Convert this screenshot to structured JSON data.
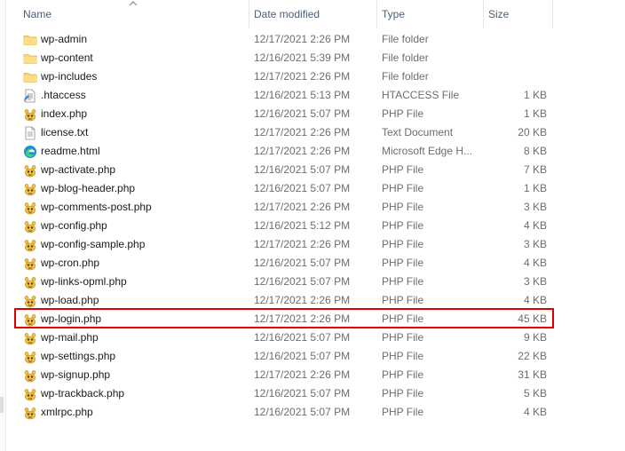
{
  "columns": {
    "name": "Name",
    "date_modified": "Date modified",
    "type": "Type",
    "size": "Size"
  },
  "sort": {
    "column": "name",
    "direction": "ascending",
    "icon": "chevron-up-icon"
  },
  "files": [
    {
      "name": "wp-admin",
      "date": "12/17/2021 2:26 PM",
      "type": "File folder",
      "size": "",
      "icon": "folder-icon"
    },
    {
      "name": "wp-content",
      "date": "12/16/2021 5:39 PM",
      "type": "File folder",
      "size": "",
      "icon": "folder-icon"
    },
    {
      "name": "wp-includes",
      "date": "12/17/2021 2:26 PM",
      "type": "File folder",
      "size": "",
      "icon": "folder-icon"
    },
    {
      "name": ".htaccess",
      "date": "12/16/2021 5:13 PM",
      "type": "HTACCESS File",
      "size": "1 KB",
      "icon": "text-file-icon"
    },
    {
      "name": "index.php",
      "date": "12/16/2021 5:07 PM",
      "type": "PHP File",
      "size": "1 KB",
      "icon": "php-file-icon"
    },
    {
      "name": "license.txt",
      "date": "12/17/2021 2:26 PM",
      "type": "Text Document",
      "size": "20 KB",
      "icon": "document-icon"
    },
    {
      "name": "readme.html",
      "date": "12/17/2021 2:26 PM",
      "type": "Microsoft Edge H...",
      "size": "8 KB",
      "icon": "edge-icon"
    },
    {
      "name": "wp-activate.php",
      "date": "12/16/2021 5:07 PM",
      "type": "PHP File",
      "size": "7 KB",
      "icon": "php-file-icon"
    },
    {
      "name": "wp-blog-header.php",
      "date": "12/16/2021 5:07 PM",
      "type": "PHP File",
      "size": "1 KB",
      "icon": "php-file-icon"
    },
    {
      "name": "wp-comments-post.php",
      "date": "12/17/2021 2:26 PM",
      "type": "PHP File",
      "size": "3 KB",
      "icon": "php-file-icon"
    },
    {
      "name": "wp-config.php",
      "date": "12/16/2021 5:12 PM",
      "type": "PHP File",
      "size": "4 KB",
      "icon": "php-file-icon"
    },
    {
      "name": "wp-config-sample.php",
      "date": "12/17/2021 2:26 PM",
      "type": "PHP File",
      "size": "3 KB",
      "icon": "php-file-icon"
    },
    {
      "name": "wp-cron.php",
      "date": "12/16/2021 5:07 PM",
      "type": "PHP File",
      "size": "4 KB",
      "icon": "php-file-icon"
    },
    {
      "name": "wp-links-opml.php",
      "date": "12/16/2021 5:07 PM",
      "type": "PHP File",
      "size": "3 KB",
      "icon": "php-file-icon"
    },
    {
      "name": "wp-load.php",
      "date": "12/17/2021 2:26 PM",
      "type": "PHP File",
      "size": "4 KB",
      "icon": "php-file-icon"
    },
    {
      "name": "wp-login.php",
      "date": "12/17/2021 2:26 PM",
      "type": "PHP File",
      "size": "45 KB",
      "icon": "php-file-icon",
      "highlighted": true
    },
    {
      "name": "wp-mail.php",
      "date": "12/16/2021 5:07 PM",
      "type": "PHP File",
      "size": "9 KB",
      "icon": "php-file-icon"
    },
    {
      "name": "wp-settings.php",
      "date": "12/16/2021 5:07 PM",
      "type": "PHP File",
      "size": "22 KB",
      "icon": "php-file-icon"
    },
    {
      "name": "wp-signup.php",
      "date": "12/17/2021 2:26 PM",
      "type": "PHP File",
      "size": "31 KB",
      "icon": "php-file-icon"
    },
    {
      "name": "wp-trackback.php",
      "date": "12/16/2021 5:07 PM",
      "type": "PHP File",
      "size": "5 KB",
      "icon": "php-file-icon"
    },
    {
      "name": "xmlrpc.php",
      "date": "12/16/2021 5:07 PM",
      "type": "PHP File",
      "size": "4 KB",
      "icon": "php-file-icon"
    }
  ],
  "colors": {
    "highlight_border": "#e00000",
    "header_text": "#4c607a",
    "folder_fill": "#f8d775",
    "php_icon": "#f0c24b"
  }
}
